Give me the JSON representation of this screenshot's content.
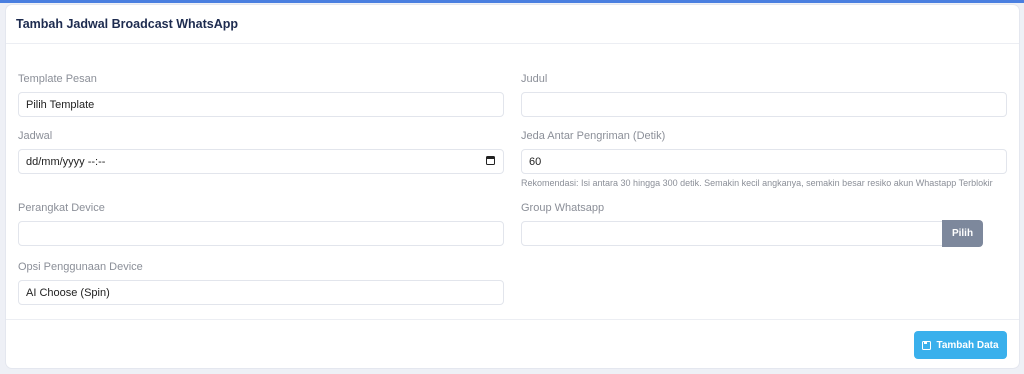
{
  "form": {
    "title": "Tambah Jadwal Broadcast WhatsApp",
    "template_pesan": {
      "label": "Template Pesan",
      "value": "Pilih Template"
    },
    "judul": {
      "label": "Judul",
      "value": ""
    },
    "jadwal": {
      "label": "Jadwal",
      "value": "dd/mm/yyyy --:--"
    },
    "jeda": {
      "label": "Jeda Antar Pengriman (Detik)",
      "value": "60",
      "help": "Rekomendasi: Isi antara 30 hingga 300 detik. Semakin kecil angkanya, semakin besar resiko akun Whastapp Terblokir"
    },
    "perangkat": {
      "label": "Perangkat Device",
      "value": ""
    },
    "group": {
      "label": "Group Whatsapp",
      "value": "",
      "button": "Pilih"
    },
    "opsi": {
      "label": "Opsi Penggunaan Device",
      "value": "AI Choose (Spin)"
    },
    "submit_label": "Tambah Data"
  },
  "colors": {
    "accent": "#3ab0ec",
    "secondary_button": "#7d889c",
    "title": "#1d2b4f"
  },
  "icons": {
    "date": "calendar-icon",
    "submit": "save-icon"
  }
}
